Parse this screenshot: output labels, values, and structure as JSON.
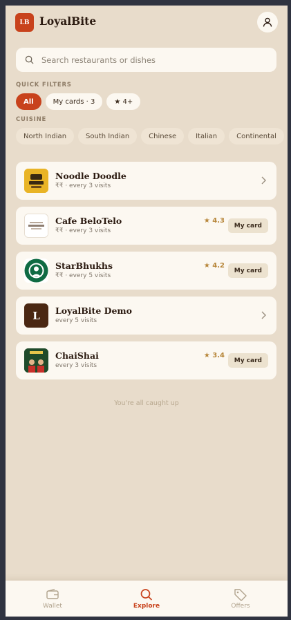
{
  "header": {
    "logo_text": "LB",
    "brand": "LoyalBite",
    "profile_icon": "user-icon"
  },
  "search": {
    "placeholder": "Search restaurants or dishes",
    "icon": "search-icon"
  },
  "quick_filters": {
    "label": "QUICK FILTERS",
    "chips": [
      "All",
      "My cards · 3",
      "★ 4+"
    ],
    "active": "All"
  },
  "cuisine": {
    "label": "CUISINE",
    "chips": [
      "North Indian",
      "South Indian",
      "Chinese",
      "Italian",
      "Continental"
    ]
  },
  "restaurants": [
    {
      "name": "Noodle Doodle",
      "sub": "₹₹ · every 3 visits",
      "rating": "",
      "action": ""
    },
    {
      "name": "Cafe BeloTelo",
      "sub": "₹₹ · every 3 visits",
      "rating": "★ 4.3",
      "action": "My card"
    },
    {
      "name": "StarBhukhs",
      "sub": "₹₹ · every 5 visits",
      "rating": "★ 4.2",
      "action": "My card"
    },
    {
      "name": "LoyalBite Demo",
      "sub": "every 5 visits",
      "rating": "",
      "action": "",
      "initial": "L"
    },
    {
      "name": "ChaiShai",
      "sub": "every 3 visits",
      "rating": "★ 3.4",
      "action": "My card"
    }
  ],
  "footer_note": "You're all caught up",
  "nav": {
    "items": [
      {
        "label": "Wallet",
        "icon": "wallet-icon"
      },
      {
        "label": "Explore",
        "icon": "search-icon"
      },
      {
        "label": "Offers",
        "icon": "tag-icon"
      }
    ],
    "active": "Explore"
  },
  "colors": {
    "accent": "#c8421c",
    "background": "#e8dccb",
    "card": "#fcf8f1",
    "rating": "#b7863a"
  }
}
